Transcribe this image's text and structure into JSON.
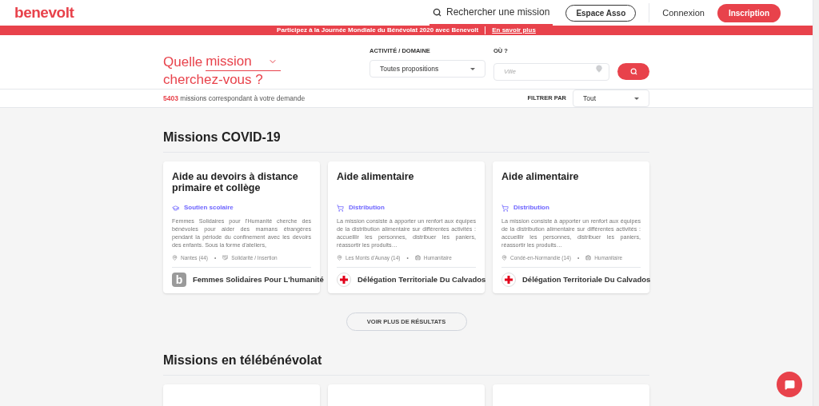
{
  "header": {
    "logo": "benevolt",
    "nav": [
      {
        "label": "Rechercher une mission",
        "kind": "search",
        "selected": true
      },
      {
        "label": "Espace Asso",
        "kind": "outline",
        "selected": false
      },
      {
        "label": "Connexion",
        "kind": "plain",
        "selected": false
      },
      {
        "label": "Inscription",
        "kind": "primary",
        "selected": false
      }
    ]
  },
  "banner": {
    "text": "Participez à la Journée Mondiale du Bénévolat 2020 avec Benevolt",
    "link": "En savoir plus"
  },
  "search": {
    "title_before": "Quelle",
    "title_select": "mission",
    "title_after": "cherchez-vous ?",
    "domain_label": "ACTIVITÉ / DOMAINE",
    "domain_value": "Toutes propositions",
    "where_label": "OÙ ?",
    "where_placeholder": "Ville"
  },
  "results": {
    "count": "5403",
    "text": "missions correspondant à votre demande",
    "filter_label": "FILTRER PAR",
    "filter_value": "Tout"
  },
  "sections": [
    {
      "title": "Missions COVID-19",
      "cards": [
        {
          "title": "Aide au devoirs à distance primaire et collège",
          "category": {
            "kind": "school",
            "label": "Soutien scolaire"
          },
          "description": "Femmes Solidaires pour l'Humanité cherche des bénévoles pour aider des mamans étrangères pendant la période du confinement avec les devoirs des enfants. Sous la forme d'ateliers,",
          "location": "Nantes (44)",
          "separator": "•",
          "domain": {
            "kind": "handshake",
            "label": "Solidarité / Insertion"
          },
          "org": {
            "kind": "letter",
            "name": "Femmes Solidaires Pour L'humanité",
            "letter": "b"
          }
        },
        {
          "title": "Aide alimentaire",
          "category": {
            "kind": "cart",
            "label": "Distribution"
          },
          "description": "La mission consiste à apporter un renfort aux équipes de la distribution alimentaire sur différentes activités : accueillir les personnes, distribuer les paniers, réassortir les produits…",
          "location": "Les Monts d'Aunay (14)",
          "separator": "•",
          "domain": {
            "kind": "kit",
            "label": "Humanitaire"
          },
          "org": {
            "kind": "cross",
            "name": "Délégation Territoriale Du Calvados"
          }
        },
        {
          "title": "Aide alimentaire",
          "category": {
            "kind": "cart",
            "label": "Distribution"
          },
          "description": "La mission consiste à apporter un renfort aux équipes de la distribution alimentaire sur différentes activités : accueillir les personnes, distribuer les paniers, réassortir les produits…",
          "location": "Condé-en-Normandie (14)",
          "separator": "•",
          "domain": {
            "kind": "kit",
            "label": "Humanitaire"
          },
          "org": {
            "kind": "cross",
            "name": "Délégation Territoriale Du Calvados"
          }
        }
      ],
      "more_button": "VOIR PLUS DE RÉSULTATS"
    },
    {
      "title": "Missions en télébénévolat"
    }
  ]
}
